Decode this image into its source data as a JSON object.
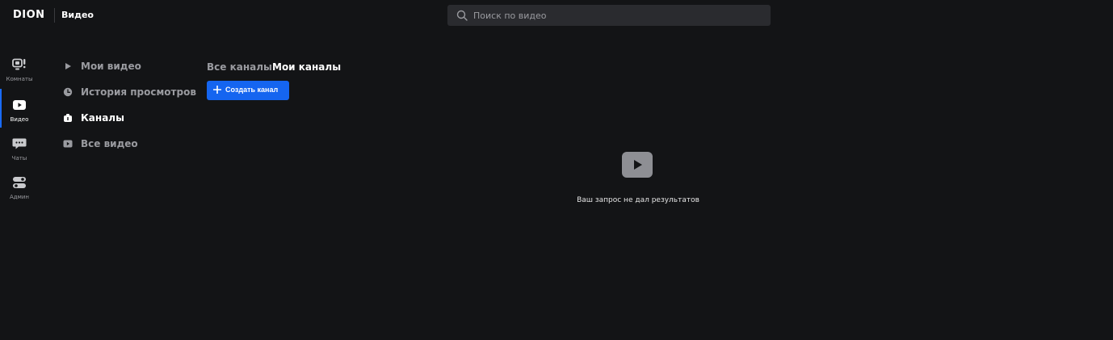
{
  "header": {
    "logo": "DION",
    "app_title": "Видео"
  },
  "search": {
    "placeholder": "Поиск по видео",
    "value": "",
    "icon": "search-icon"
  },
  "rail": {
    "items": [
      {
        "label": "Комнаты",
        "icon": "rooms-icon",
        "active": false
      },
      {
        "label": "Видео",
        "icon": "video-icon",
        "active": true
      },
      {
        "label": "Чаты",
        "icon": "chats-icon",
        "active": false
      },
      {
        "label": "Админ",
        "icon": "admin-icon",
        "active": false
      }
    ]
  },
  "nav": {
    "items": [
      {
        "label": "Мои видео",
        "icon": "play-icon",
        "active": false
      },
      {
        "label": "История просмотров",
        "icon": "history-icon",
        "active": false
      },
      {
        "label": "Каналы",
        "icon": "channels-icon",
        "active": true
      },
      {
        "label": "Все видео",
        "icon": "video-icon",
        "active": false
      }
    ]
  },
  "tabs": {
    "all_channels": "Все каналы",
    "my_channels": "Мои каналы"
  },
  "actions": {
    "create_channel": "Создать канал"
  },
  "empty_state": {
    "icon": "video-placeholder-icon",
    "text": "Ваш запрос не дал результатов"
  },
  "colors": {
    "background": "#131416",
    "accent": "#1565f0",
    "muted_text": "#9a9ba0",
    "search_bg": "#2a2b2f"
  }
}
